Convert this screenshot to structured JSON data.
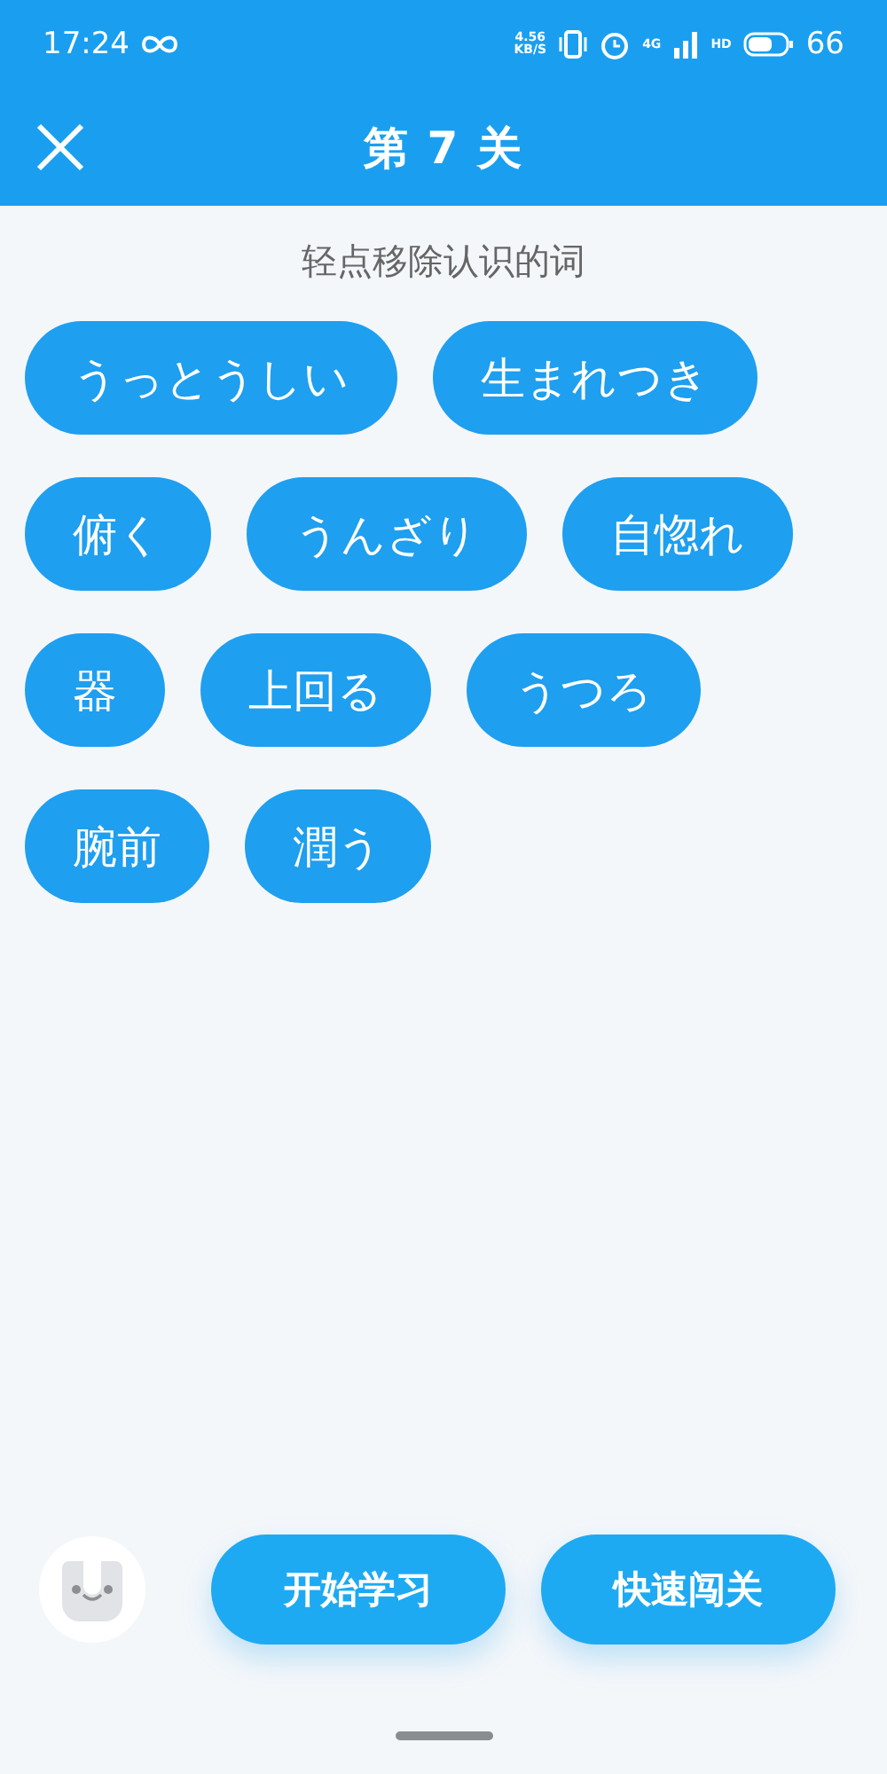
{
  "status_bar": {
    "time": "17:24",
    "speed_value": "4.56",
    "speed_unit": "KB/S",
    "network": "4G",
    "hd": "HD",
    "battery": "66"
  },
  "header": {
    "title": "第 7 关"
  },
  "instruction": "轻点移除认识的词",
  "words": [
    {
      "text": "うっとうしい"
    },
    {
      "text": "生まれつき"
    },
    {
      "text": "俯く"
    },
    {
      "text": "うんざり"
    },
    {
      "text": "自惚れ"
    },
    {
      "text": "器"
    },
    {
      "text": "上回る"
    },
    {
      "text": "うつろ"
    },
    {
      "text": "腕前"
    },
    {
      "text": "潤う"
    }
  ],
  "buttons": [
    {
      "label": "开始学习"
    },
    {
      "label": "快速闯关"
    }
  ]
}
